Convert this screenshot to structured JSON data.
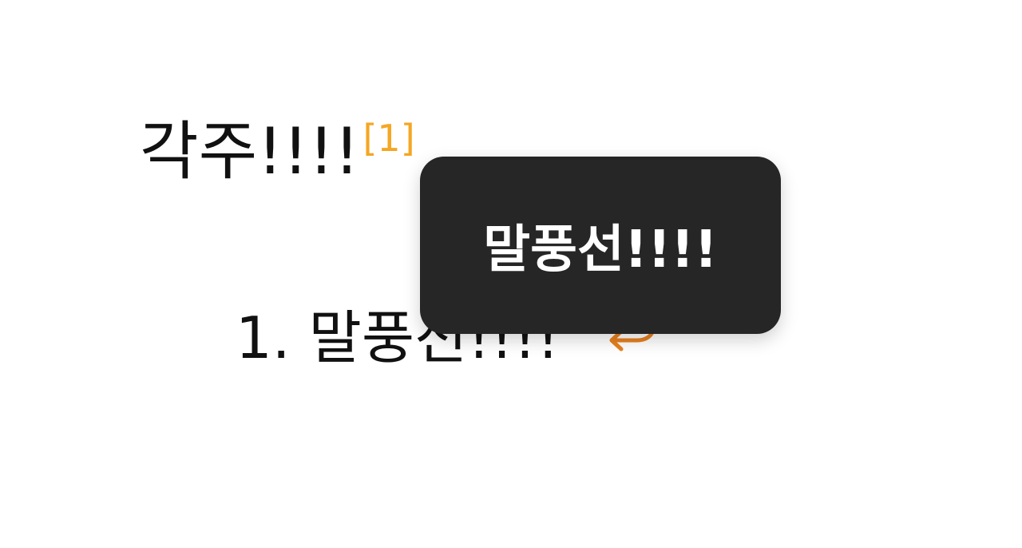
{
  "content": {
    "main_text": "각주!!!!",
    "footnote_ref": "[1]"
  },
  "footnotes": {
    "items": [
      {
        "number": "1.",
        "text": "말풍선!!!!",
        "backref_icon": "return-arrow-icon"
      }
    ]
  },
  "tooltip": {
    "text": "말풍선!!!!"
  },
  "colors": {
    "footnote_ref": "#f5a623",
    "backref": "#e8801f",
    "tooltip_bg": "#262626",
    "text": "#111111"
  }
}
